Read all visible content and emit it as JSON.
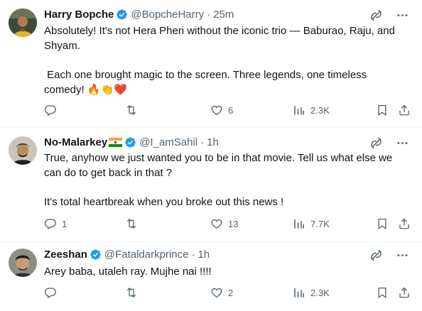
{
  "tweets": [
    {
      "name": "Harry Bopche",
      "handle": "@BopcheHarry",
      "dot": "·",
      "time": "25m",
      "line1": "Absolutely! It's not Hera Pheri without the iconic trio — Baburao, Raju, and Shyam.",
      "line2": " Each one brought magic to the screen. Three legends, one timeless comedy! 🔥👏❤️",
      "replies": "",
      "retweets": "",
      "likes": "6",
      "views": "2.3K"
    },
    {
      "name": "No-Malarkey",
      "handle": "@I_amSahil",
      "dot": "·",
      "time": "1h",
      "line1": "True, anyhow we just wanted you to be in that movie. Tell us what else we can do to get back in that ?",
      "line2": "It's total heartbreak when you broke out this news !",
      "replies": "1",
      "retweets": "",
      "likes": "13",
      "views": "7.7K"
    },
    {
      "name": "Zeeshan",
      "handle": "@Fataldarkprince",
      "dot": "·",
      "time": "1h",
      "line1": "Arey baba, utaleh ray. Mujhe nai !!!!",
      "line2": "",
      "replies": "",
      "retweets": "",
      "likes": "2",
      "views": "2.3K"
    }
  ],
  "icons": {
    "verified": "verified-badge-icon",
    "grok": "grok-icon",
    "more": "more-icon",
    "reply": "reply-icon",
    "retweet": "retweet-icon",
    "like": "like-icon",
    "views": "views-icon",
    "bookmark": "bookmark-icon",
    "share": "share-icon"
  },
  "colors": {
    "verified": "#1d9bf0",
    "text": "#0f1419",
    "secondary": "#536471"
  }
}
